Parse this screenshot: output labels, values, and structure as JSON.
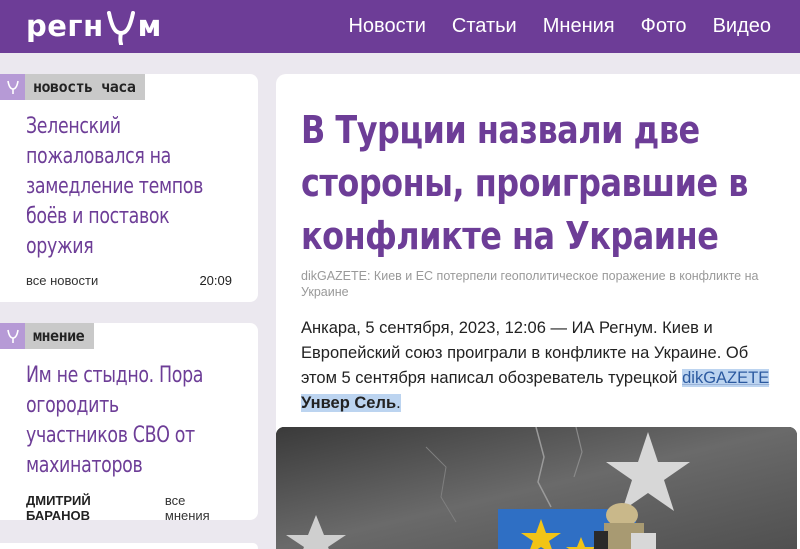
{
  "header": {
    "logo_text_left": "регн",
    "logo_text_right": "м",
    "nav": [
      "Новости",
      "Статьи",
      "Мнения",
      "Фото",
      "Видео"
    ]
  },
  "sidebar": {
    "cards": [
      {
        "tag": "новость часа",
        "title_lines": [
          "Зеленский",
          "пожаловался на",
          "замедление темпов",
          "боёв и поставок",
          "оружия"
        ],
        "meta_left": "все новости",
        "meta_right": "20:09"
      },
      {
        "tag": "мнение",
        "title_lines": [
          "Им не стыдно. Пора",
          "огородить",
          "участников СВО от",
          "махинаторов"
        ],
        "author": "ДМИТРИЙ БАРАНОВ",
        "meta_right": "все мнения"
      }
    ]
  },
  "article": {
    "headline_lines": [
      "В Турции назвали две",
      "стороны, проигравшие в",
      "конфликте на Украине"
    ],
    "subhead": "dikGAZETE: Киев и ЕС потерпели геополитическое поражение в конфликте на Украине",
    "lead_start": "Анкара, 5 сентября, 2023, 12:06 — ИА Регнум.   Киев и Европейский союз проиграли в конфликте на Украине. Об этом 5 сентября написал обозреватель турецкой ",
    "lead_link": "dikGAZETE",
    "lead_name": "Унвер Сель",
    "lead_end": "."
  },
  "colors": {
    "brand": "#6d3d97",
    "tag_icon": "#b69ad6",
    "tag_bg": "#c9c9c9",
    "page_bg": "#ebe8ef",
    "highlight": "#bcd4f0"
  }
}
